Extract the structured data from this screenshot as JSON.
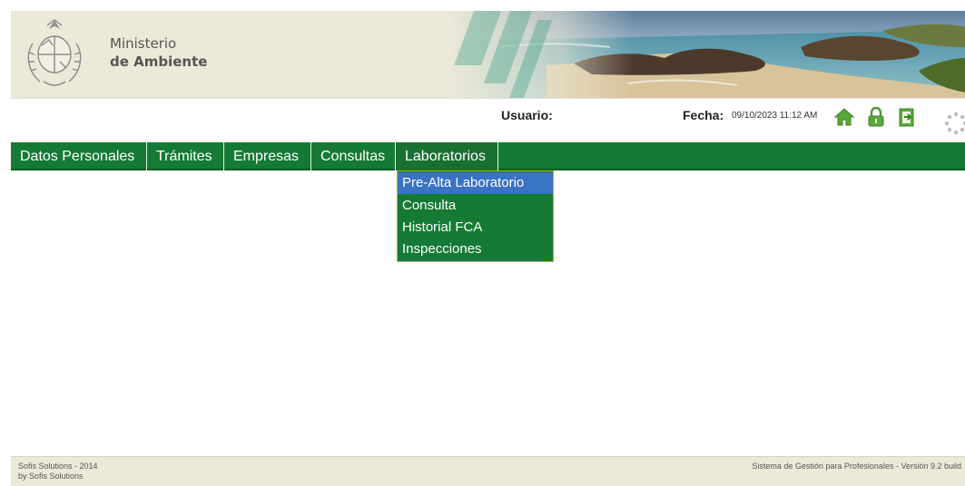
{
  "header": {
    "ministry_line1": "Ministerio",
    "ministry_line2": "de Ambiente"
  },
  "infobar": {
    "user_label": "Usuario:",
    "fecha_label": "Fecha:",
    "fecha_value": "09/10/2023 11:12 AM",
    "icons": [
      "home-icon",
      "lock-icon",
      "exit-icon",
      "loading-spinner-icon"
    ]
  },
  "menu": {
    "items": [
      {
        "label": "Datos Personales"
      },
      {
        "label": "Trámites"
      },
      {
        "label": "Empresas"
      },
      {
        "label": "Consultas"
      },
      {
        "label": "Laboratorios"
      }
    ],
    "active_index": 4
  },
  "dropdown": {
    "items": [
      {
        "label": "Pre-Alta Laboratorio"
      },
      {
        "label": "Consulta"
      },
      {
        "label": "Historial FCA"
      },
      {
        "label": "Inspecciones"
      }
    ],
    "highlighted_index": 0
  },
  "footer": {
    "line1": "Sofis Solutions - 2014",
    "line2": "by Sofis Solutions",
    "right": "Sistema de Gestión para Profesionales - Versión 9.2 build"
  },
  "colors": {
    "menu_green": "#157a35",
    "highlight_blue": "#3a72c4",
    "header_beige": "#ece9d8",
    "icon_green": "#5aa83a"
  }
}
